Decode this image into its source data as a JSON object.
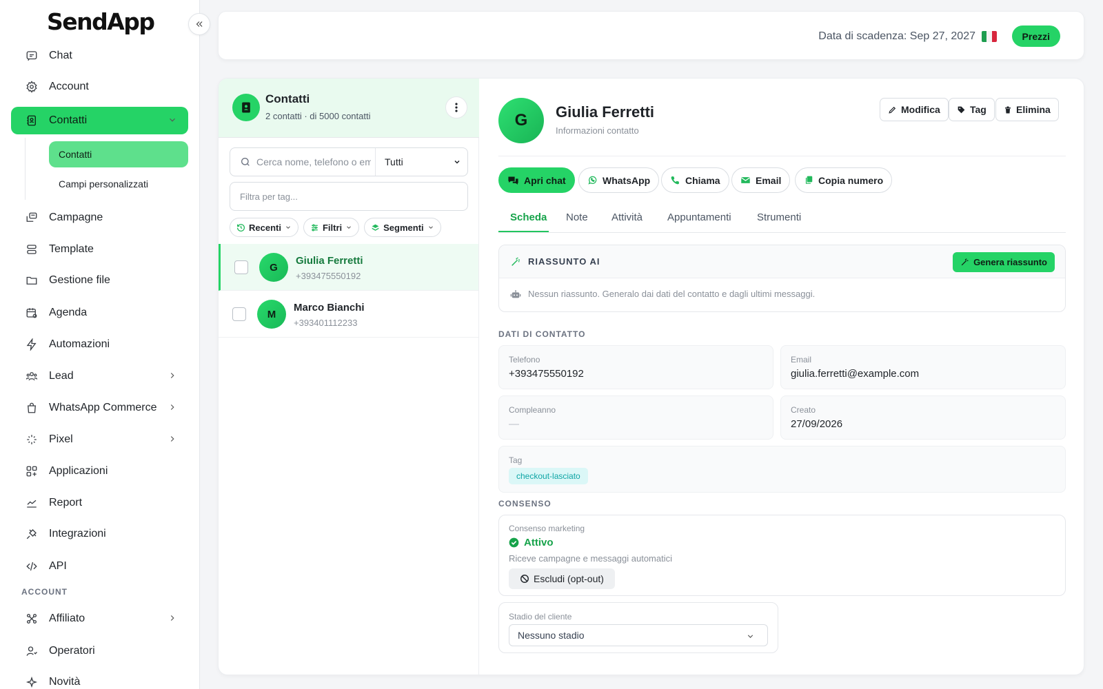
{
  "app": {
    "logo": "SendApp"
  },
  "sidebar": {
    "items": [
      {
        "label": "Chat",
        "icon": "chat-icon"
      },
      {
        "label": "Account",
        "icon": "gear-icon"
      },
      {
        "label": "Contatti",
        "icon": "contacts-book-icon",
        "expanded": true,
        "active": true
      },
      {
        "label": "Campagne",
        "icon": "campaign-icon"
      },
      {
        "label": "Template",
        "icon": "template-icon"
      },
      {
        "label": "Gestione file",
        "icon": "folder-icon"
      },
      {
        "label": "Agenda",
        "icon": "calendar-icon"
      },
      {
        "label": "Automazioni",
        "icon": "bolt-icon"
      },
      {
        "label": "Lead",
        "icon": "users-icon",
        "has_children": true
      },
      {
        "label": "WhatsApp Commerce",
        "icon": "shopping-bag-icon",
        "has_children": true
      },
      {
        "label": "Pixel",
        "icon": "pixel-icon",
        "has_children": true
      },
      {
        "label": "Applicazioni",
        "icon": "apps-icon"
      },
      {
        "label": "Report",
        "icon": "chart-line-icon"
      },
      {
        "label": "Integrazioni",
        "icon": "plug-icon"
      },
      {
        "label": "API",
        "icon": "code-icon"
      }
    ],
    "sub_items": [
      {
        "label": "Contatti",
        "active": true
      },
      {
        "label": "Campi personalizzati"
      }
    ],
    "section_account": "ACCOUNT",
    "account_items": [
      {
        "label": "Affiliato",
        "icon": "affiliate-icon",
        "has_children": true
      },
      {
        "label": "Operatori",
        "icon": "operator-icon"
      },
      {
        "label": "Novità",
        "icon": "sparkles-icon"
      }
    ]
  },
  "topbar": {
    "expiry": "Data di scadenza: Sep 27, 2027",
    "language_flag": "italy-flag-icon",
    "prezzi_label": "Prezzi"
  },
  "contacts_panel": {
    "title": "Contatti",
    "subtitle": "2 contatti · di 5000 contatti",
    "search_placeholder": "Cerca nome, telefono o email",
    "filter_select": "Tutti",
    "tag_filter_placeholder": "Filtra per tag...",
    "chips": [
      "Recenti",
      "Filtri",
      "Segmenti"
    ],
    "contacts": [
      {
        "initial": "G",
        "name": "Giulia Ferretti",
        "phone": "+393475550192",
        "selected": true
      },
      {
        "initial": "M",
        "name": "Marco Bianchi",
        "phone": "+393401112233",
        "selected": false
      }
    ]
  },
  "detail": {
    "initial": "G",
    "name": "Giulia Ferretti",
    "subtitle": "Informazioni contatto",
    "actions": {
      "edit": "Modifica",
      "tag": "Tag",
      "delete": "Elimina"
    },
    "quick_actions": {
      "open_chat": "Apri chat",
      "whatsapp": "WhatsApp",
      "call": "Chiama",
      "email": "Email",
      "copy": "Copia numero"
    },
    "tabs": [
      "Scheda",
      "Note",
      "Attività",
      "Appuntamenti",
      "Strumenti"
    ],
    "active_tab": "Scheda",
    "ai": {
      "title": "RIASSUNTO AI",
      "button": "Genera riassunto",
      "empty": "Nessun riassunto. Generalo dai dati del contatto e dagli ultimi messaggi."
    },
    "contact_data": {
      "section": "DATI DI CONTATTO",
      "phone_label": "Telefono",
      "phone": "+393475550192",
      "email_label": "Email",
      "email": "giulia.ferretti@example.com",
      "birthday_label": "Compleanno",
      "birthday": "—",
      "created_label": "Creato",
      "created": "27/09/2026",
      "tag_label": "Tag",
      "tag": "checkout-lasciato"
    },
    "consent": {
      "section": "CONSENSO",
      "label": "Consenso marketing",
      "status": "Attivo",
      "description": "Riceve campagne e messaggi automatici",
      "optout_button": "Escludi (opt-out)"
    },
    "stage": {
      "label": "Stadio del cliente",
      "value": "Nessuno stadio"
    }
  },
  "colors": {
    "accent": "#25d366",
    "accent_text": "#16a34a",
    "tag_bg": "#dbf7f7",
    "tag_text": "#0ea5a5"
  }
}
